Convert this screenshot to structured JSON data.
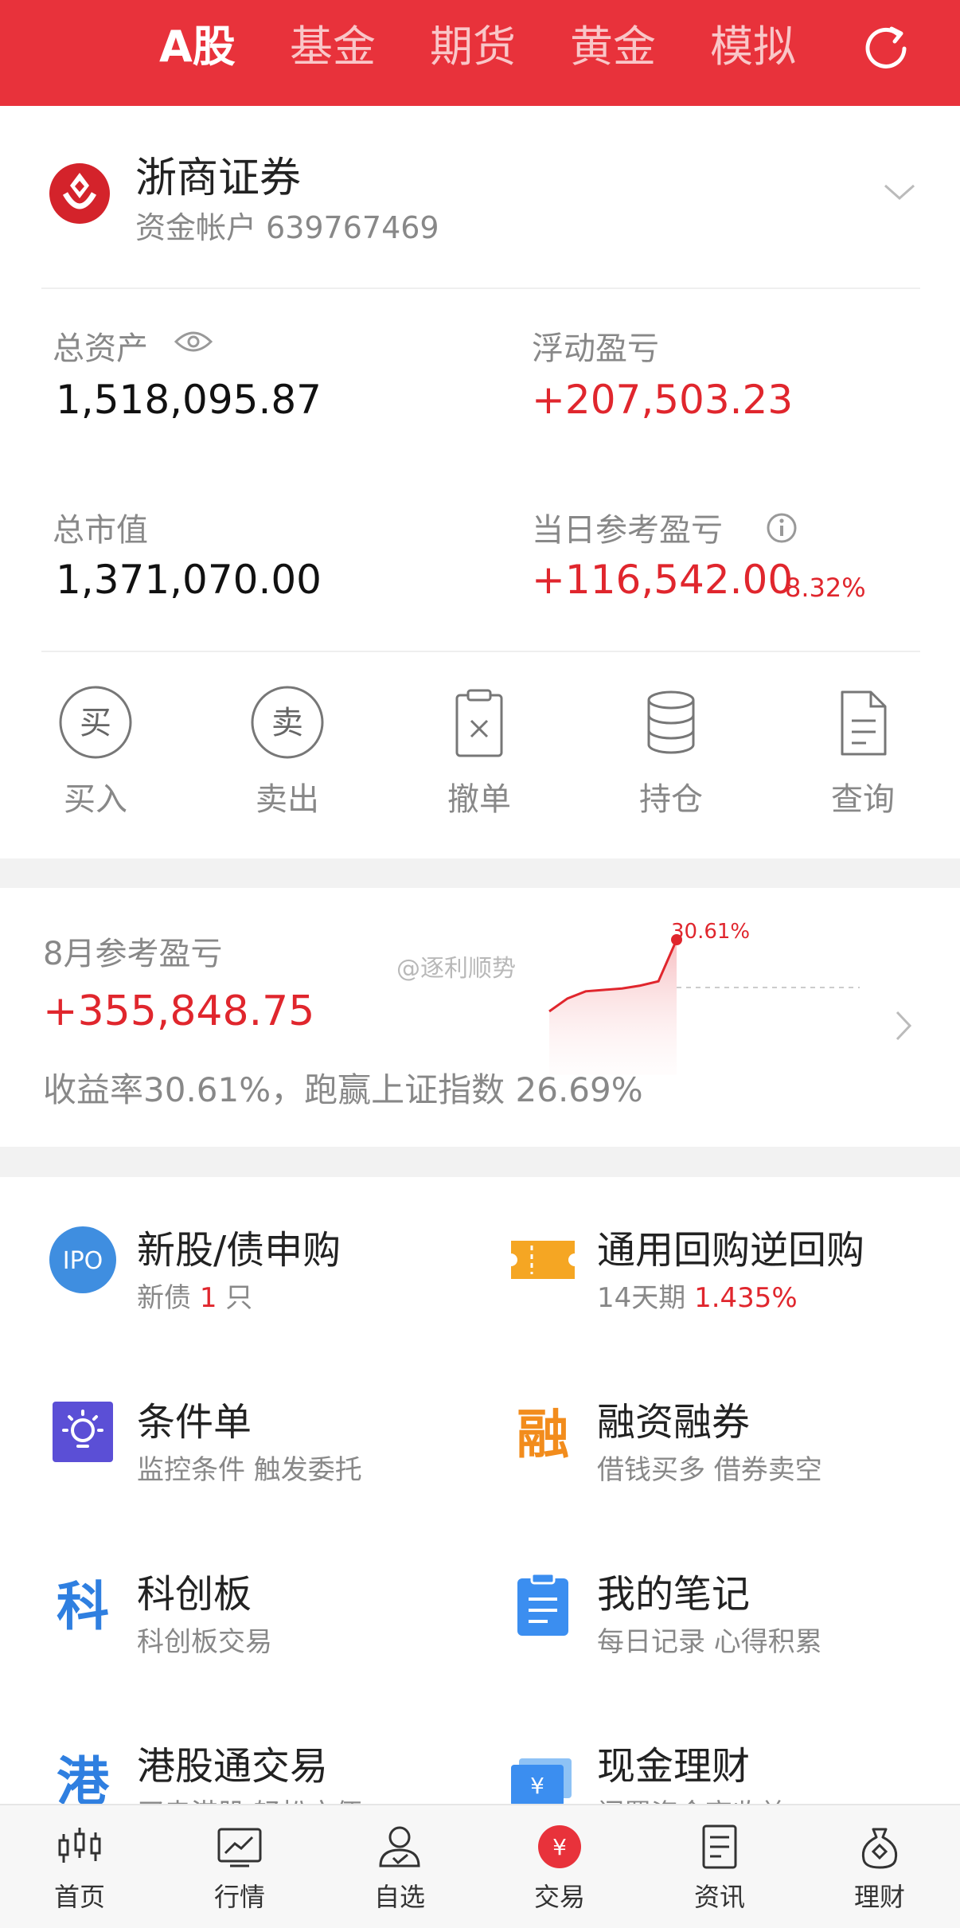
{
  "top_tabs": [
    "A股",
    "基金",
    "期货",
    "黄金",
    "模拟"
  ],
  "account": {
    "broker_name": "浙商证券",
    "account_label": "资金帐户",
    "account_number": "639767469"
  },
  "stats": {
    "total_assets_label": "总资产",
    "total_assets_value": "1,518,095.87",
    "floating_pl_label": "浮动盈亏",
    "floating_pl_value": "+207,503.23",
    "market_value_label": "总市值",
    "market_value_value": "1,371,070.00",
    "daily_pl_label": "当日参考盈亏",
    "daily_pl_value": "+116,542.00",
    "daily_pl_pct": "8.32%"
  },
  "actions": [
    "买入",
    "卖出",
    "撤单",
    "持仓",
    "查询"
  ],
  "action_glyphs": {
    "buy": "买",
    "sell": "卖"
  },
  "monthly": {
    "title": "8月参考盈亏",
    "value": "+355,848.75",
    "description": "收益率30.61%，跑赢上证指数 26.69%",
    "chart_peak_label": "30.61%",
    "watermark": "@逐利顺势",
    "sparkline": [
      0.0,
      0.18,
      0.28,
      0.3,
      0.32,
      0.36,
      0.42,
      1.0
    ]
  },
  "services": [
    {
      "title": "新股/债申购",
      "sub_prefix": "新债",
      "sub_highlight": "1",
      "sub_suffix": "只",
      "icon": "ipo-icon",
      "icon_text": "IPO"
    },
    {
      "title": "通用回购逆回购",
      "sub_prefix": "14天期",
      "sub_highlight": "1.435%",
      "sub_suffix": "",
      "icon": "ticket-icon"
    },
    {
      "title": "条件单",
      "sub_prefix": "监控条件 触发委托",
      "sub_highlight": "",
      "sub_suffix": "",
      "icon": "bulb-icon"
    },
    {
      "title": "融资融券",
      "sub_prefix": "借钱买多 借券卖空",
      "sub_highlight": "",
      "sub_suffix": "",
      "icon": "margin-icon",
      "icon_text": "融"
    },
    {
      "title": "科创板",
      "sub_prefix": "科创板交易",
      "sub_highlight": "",
      "sub_suffix": "",
      "icon": "star-market-icon",
      "icon_text": "科"
    },
    {
      "title": "我的笔记",
      "sub_prefix": "每日记录 心得积累",
      "sub_highlight": "",
      "sub_suffix": "",
      "icon": "notes-icon"
    },
    {
      "title": "港股通交易",
      "sub_prefix": "买卖港股 轻松方便",
      "sub_highlight": "",
      "sub_suffix": "",
      "icon": "hk-connect-icon",
      "icon_text": "港"
    },
    {
      "title": "现金理财",
      "sub_prefix": "闲置资金高收益",
      "sub_highlight": "",
      "sub_suffix": "",
      "icon": "cash-icon"
    }
  ],
  "bottom_nav": [
    "首页",
    "行情",
    "自选",
    "交易",
    "资讯",
    "理财"
  ],
  "nav_trade_glyph": "¥",
  "colors": {
    "brand_red": "#e8323b",
    "text_red": "#e0262d",
    "muted": "#888888"
  }
}
